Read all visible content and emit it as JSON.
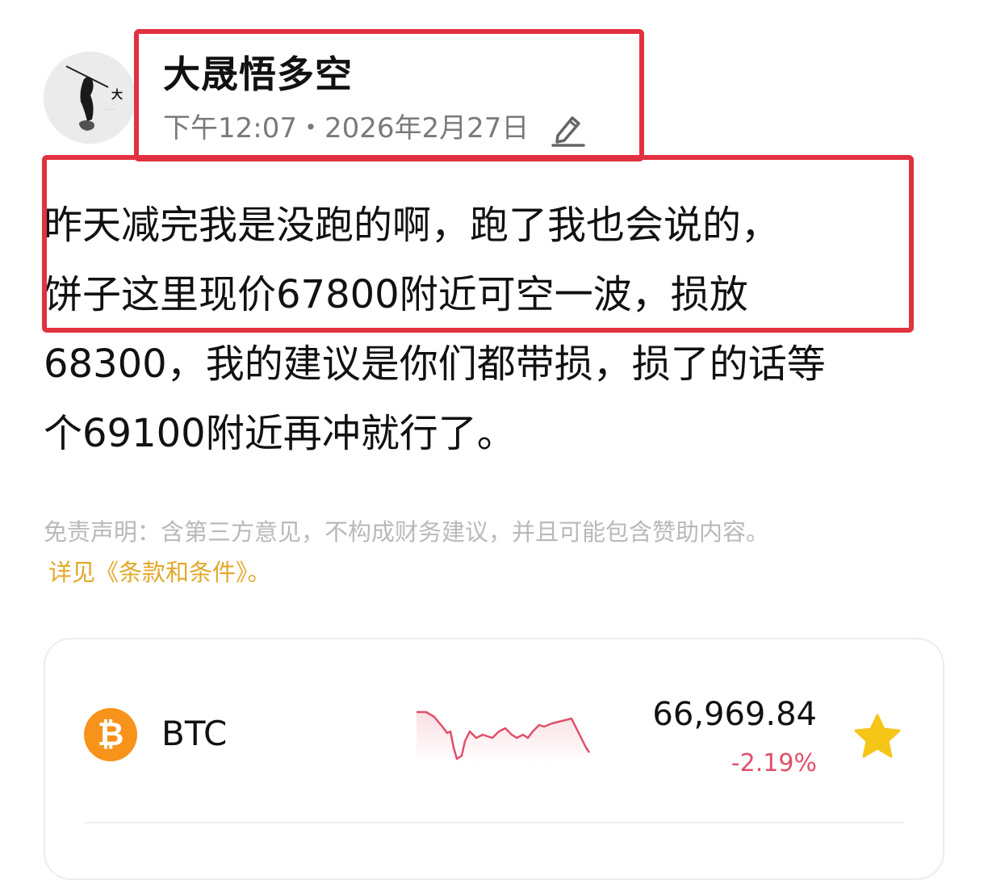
{
  "post": {
    "author": "大晟悟多空",
    "time": "下午12:07",
    "separator": "・",
    "date": "2026年2月27日",
    "lines": [
      "昨天减完我是没跑的啊，跑了我也会说的，",
      "饼子这里现价67800附近可空一波，损放",
      "68300，我的建议是你们都带损，损了的话等",
      "个69100附近再冲就行了。"
    ],
    "avatar_glyph": "大"
  },
  "disclaimer": {
    "text": "免责声明：含第三方意见，不构成财务建议，并且可能包含赞助内容。",
    "link": "详见《条款和条件》。"
  },
  "ticker": {
    "symbol": "BTC",
    "icon_glyph": "₿",
    "price": "66,969.84",
    "change": "-2.19%",
    "accent": "#f7931a",
    "change_color": "#e04f6a",
    "star_color": "#f5c518",
    "favorited": true
  },
  "annotation_color": "#e2313f"
}
